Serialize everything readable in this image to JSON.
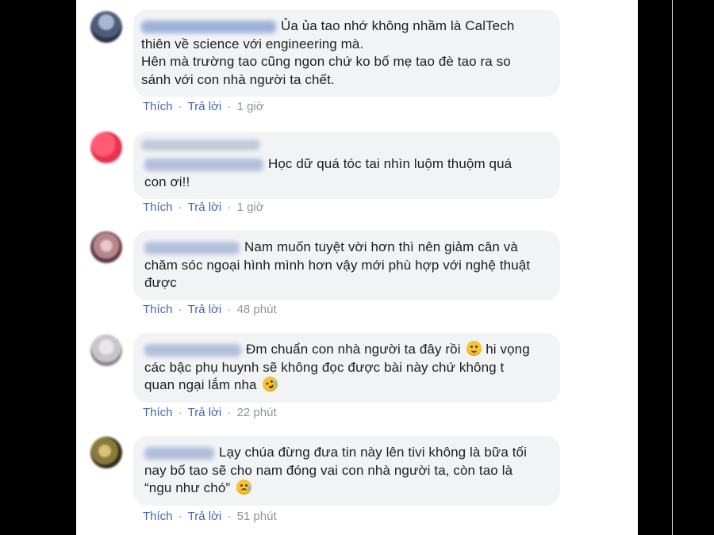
{
  "actions": {
    "like": "Thích",
    "reply": "Trả lời",
    "separator": "·"
  },
  "comments": [
    {
      "avatar_color": "#7a8aa8",
      "lines": [
        "Ủa ủa tao nhớ không nhầm là CalTech",
        "thiên về science với engineering mà.",
        "Hên mà trường tao cũng ngon chứ ko bố mẹ tao đè tao ra so",
        "sánh với con nhà người ta chết."
      ],
      "time": "1 giờ"
    },
    {
      "avatar_color": "#e8334f",
      "lines": [
        "Học dữ quá tóc tai nhìn luộm thuộm quá",
        "con ơi!!"
      ],
      "time": "1 giờ"
    },
    {
      "avatar_color": "#b9858c",
      "lines": [
        "Nam muốn tuyệt vời hơn thì nên giảm cân và",
        "chăm sóc ngoại hình mình hơn vậy mới phù hợp với nghệ thuật",
        "được"
      ],
      "time": "48 phút"
    },
    {
      "avatar_color": "#c9c5cb",
      "lines": [
        "Đm chuẩn con nhà người ta đây rồi",
        "hi vọng",
        "các bậc phụ huynh sẽ không đọc được bài này chứ không t",
        "quan ngại lắm nha"
      ],
      "time": "22 phút"
    },
    {
      "avatar_color": "#8a7a3a",
      "lines": [
        "Lạy chúa đừng đưa tin này lên tivi không là bữa tối",
        "nay bố tao sẽ cho nam đóng vai con nhà người ta, còn tao là",
        "“ngu như chó”"
      ],
      "time": "51 phút"
    }
  ]
}
